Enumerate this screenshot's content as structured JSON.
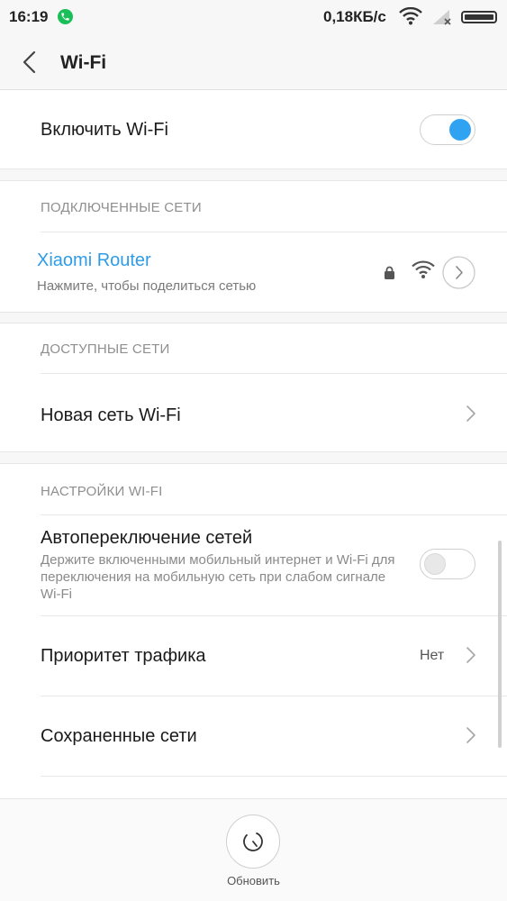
{
  "status_bar": {
    "time": "16:19",
    "call_icon": "phone-call-icon",
    "network_speed": "0,18КБ/с",
    "wifi_icon": "wifi-signal-icon",
    "cell_icon": "cell-signal-no-sim-icon",
    "battery_icon": "battery-full-icon"
  },
  "header": {
    "back_icon": "chevron-left-icon",
    "title": "Wi-Fi"
  },
  "wifi_toggle": {
    "label": "Включить Wi-Fi",
    "state": "on"
  },
  "connected": {
    "heading": "ПОДКЛЮЧЕННЫЕ СЕТИ",
    "network": {
      "name": "Xiaomi Router",
      "subtitle": "Нажмите, чтобы поделиться сетью",
      "lock_icon": "lock-icon",
      "signal_icon": "wifi-signal-icon",
      "detail_icon": "chevron-right-circle-icon"
    }
  },
  "available": {
    "heading": "ДОСТУПНЫЕ СЕТИ",
    "new_network_label": "Новая сеть Wi-Fi"
  },
  "settings": {
    "heading": "НАСТРОЙКИ WI-FI",
    "auto_switch": {
      "label": "Автопереключение сетей",
      "description": "Держите включенными мобильный интернет и Wi-Fi для переключения на мобильную сеть при слабом сигнале Wi-Fi",
      "state": "off"
    },
    "traffic_priority": {
      "label": "Приоритет трафика",
      "value": "Нет"
    },
    "saved_networks": {
      "label": "Сохраненные сети"
    }
  },
  "bottom": {
    "refresh_icon": "refresh-icon",
    "refresh_label": "Обновить"
  },
  "colors": {
    "accent": "#2fa3f2",
    "link": "#2f9ce6",
    "call": "#1bbf5a"
  }
}
